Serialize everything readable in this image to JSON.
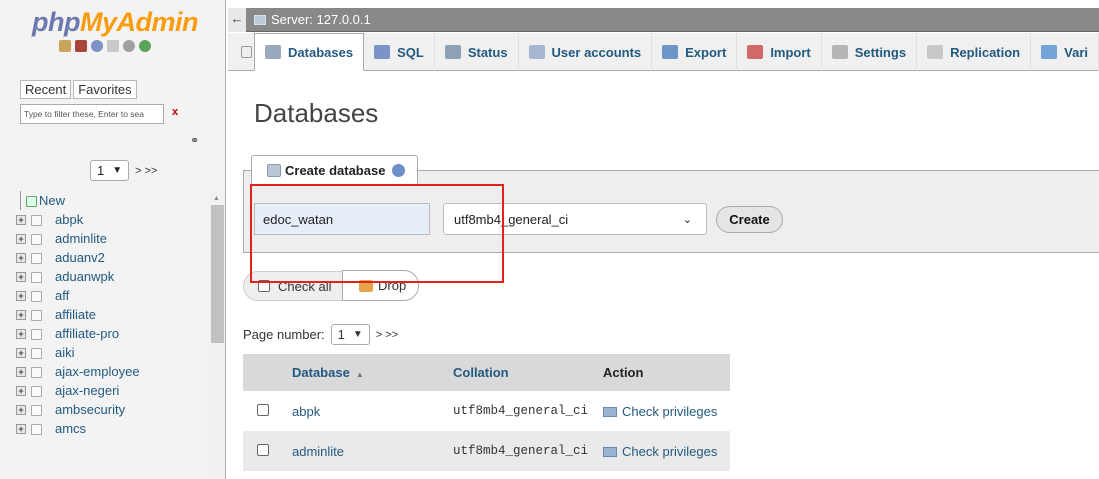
{
  "sidebar": {
    "logo_php": "php",
    "logo_rest": "MyAdmin",
    "tabs": [
      "Recent",
      "Favorites"
    ],
    "filter_placeholder": "Type to filter these, Enter to sea",
    "filter_clear": "x",
    "page_select": "1",
    "page_next": "> >>",
    "tree": [
      {
        "label": "New",
        "type": "new"
      },
      {
        "label": "abpk"
      },
      {
        "label": "adminlite"
      },
      {
        "label": "aduanv2"
      },
      {
        "label": "aduanwpk"
      },
      {
        "label": "aff"
      },
      {
        "label": "affiliate"
      },
      {
        "label": "affiliate-pro"
      },
      {
        "label": "aiki"
      },
      {
        "label": "ajax-employee"
      },
      {
        "label": "ajax-negeri"
      },
      {
        "label": "ambsecurity"
      },
      {
        "label": "amcs"
      }
    ]
  },
  "topbar": {
    "collapse_glyph": "←",
    "server": "Server: 127.0.0.1"
  },
  "tabs": [
    {
      "label": "Databases",
      "icon": "database-icon",
      "color": "#9aa9bd",
      "active": true
    },
    {
      "label": "SQL",
      "icon": "sql-icon",
      "color": "#7b93c9"
    },
    {
      "label": "Status",
      "icon": "status-icon",
      "color": "#8e9fb6"
    },
    {
      "label": "User accounts",
      "icon": "users-icon",
      "color": "#a7b7d1"
    },
    {
      "label": "Export",
      "icon": "export-icon",
      "color": "#6d95c7"
    },
    {
      "label": "Import",
      "icon": "import-icon",
      "color": "#d06a6a"
    },
    {
      "label": "Settings",
      "icon": "wrench-icon",
      "color": "#b5b5b5"
    },
    {
      "label": "Replication",
      "icon": "replication-icon",
      "color": "#c8c8c8"
    },
    {
      "label": "Vari",
      "icon": "variables-icon",
      "color": "#74a3d6"
    }
  ],
  "main": {
    "title": "Databases",
    "create_tab": "Create database",
    "db_name_value": "edoc_watan",
    "collation_value": "utf8mb4_general_ci",
    "create_button": "Create",
    "check_all": "Check all",
    "drop_button": "Drop",
    "page_number_label": "Page number:",
    "page_number_value": "1",
    "page_next": "> >>"
  },
  "table": {
    "headers": [
      "Database",
      "Collation",
      "Action"
    ],
    "rows": [
      {
        "database": "abpk",
        "collation": "utf8mb4_general_ci",
        "action": "Check privileges"
      },
      {
        "database": "adminlite",
        "collation": "utf8mb4_general_ci",
        "action": "Check privileges"
      }
    ]
  },
  "colors": {
    "link": "#235a81",
    "highlight": "#e3231b",
    "logo_php": "#6c78af",
    "logo_admin": "#f89c0e"
  }
}
